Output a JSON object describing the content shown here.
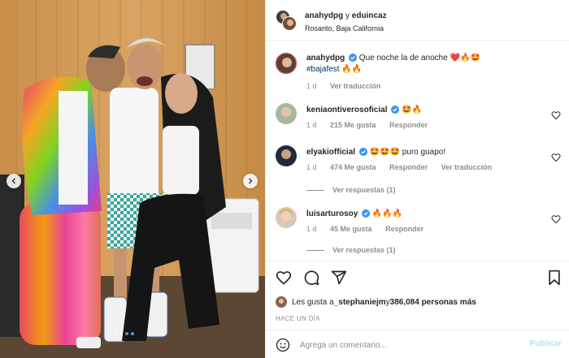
{
  "post": {
    "header": {
      "user1": "anahydpg",
      "connector": " y ",
      "user2": "eduincaz",
      "location": "Rosarito, Baja California"
    },
    "caption": {
      "username": "anahydpg",
      "text": "Que noche la de anoche ❤️🔥🤩",
      "hashtag": "#bajafest",
      "trailing": " 🔥🔥",
      "time": "1 d",
      "translate": "Ver traducción"
    },
    "comments": [
      {
        "username": "keniaontiverosoficial",
        "text": "🤩🔥",
        "time": "1 d",
        "likes": "215 Me gusta",
        "reply": "Responder"
      },
      {
        "username": "elyakiofficial",
        "text": "🤩🤩🤩 puro guapo!",
        "time": "1 d",
        "likes": "474 Me gusta",
        "reply": "Responder",
        "translate": "Ver traducción",
        "view_replies": "Ver respuestas (1)"
      },
      {
        "username": "luisarturosoy",
        "text": "🔥🔥🔥",
        "time": "1 d",
        "likes": "45 Me gusta",
        "reply": "Responder",
        "view_replies": "Ver respuestas (1)"
      }
    ],
    "likes": {
      "prefix": "Les gusta a ",
      "user": "_stephaniejm",
      "middle": " y ",
      "count": "386,084 personas más"
    },
    "time_ago": "HACE UN DÍA",
    "add_comment": {
      "placeholder": "Agrega un comentario...",
      "publish": "Publicar"
    },
    "carousel": {
      "total": 4,
      "active_index": 3
    }
  },
  "colors": {
    "verified": "#3897f0",
    "link": "#00376b",
    "muted": "#8e8e8e",
    "publish_disabled": "#b2dffc",
    "border": "#efefef"
  },
  "icons": [
    "heart-icon",
    "comment-icon",
    "share-icon",
    "bookmark-icon",
    "emoji-icon",
    "verified-icon",
    "chevron-left-icon",
    "chevron-right-icon"
  ]
}
